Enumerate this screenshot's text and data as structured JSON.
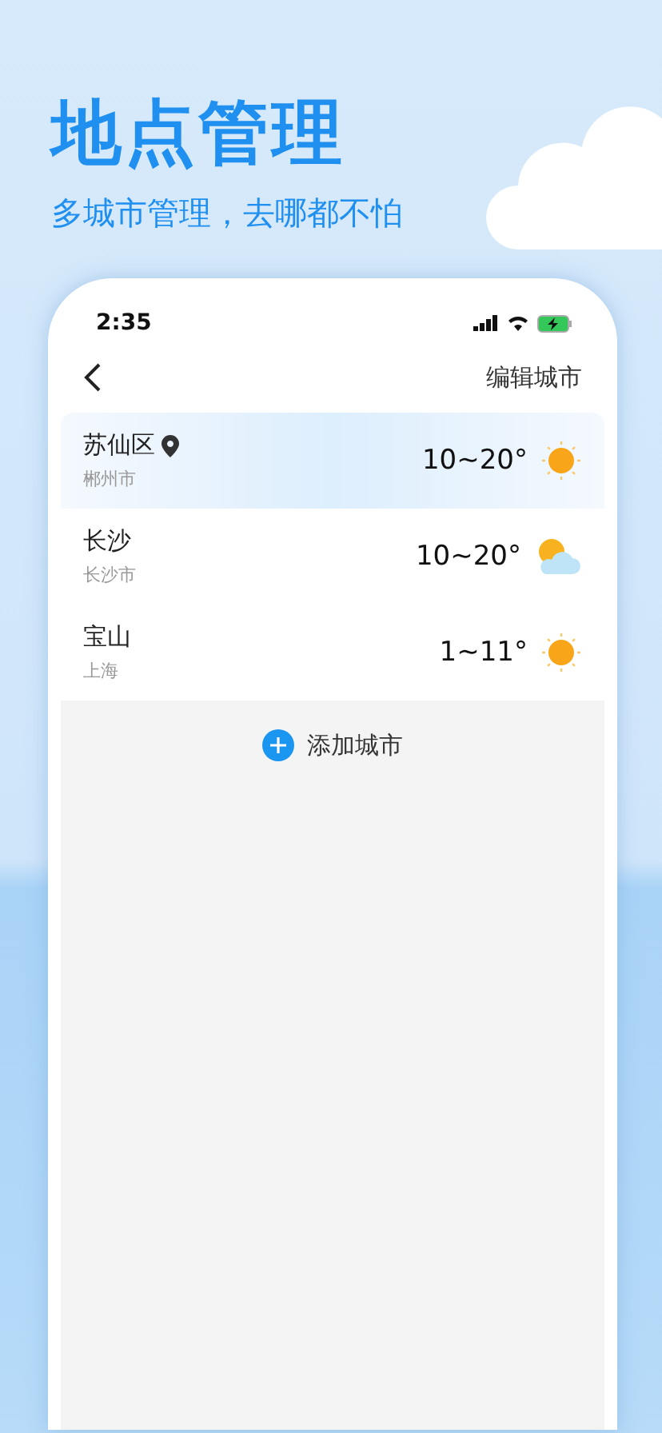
{
  "headline": {
    "title": "地点管理",
    "subtitle": "多城市管理，去哪都不怕"
  },
  "status_bar": {
    "time": "2:35"
  },
  "nav": {
    "action": "编辑城市"
  },
  "cities": [
    {
      "name": "苏仙区",
      "region": "郴州市",
      "located": true,
      "selected": true,
      "temps": "10~20°",
      "weather_icon": {
        "kind": "sun"
      }
    },
    {
      "name": "长沙",
      "region": "长沙市",
      "located": false,
      "selected": false,
      "temps": "10~20°",
      "weather_icon": {
        "kind": "sun-cloud"
      }
    },
    {
      "name": "宝山",
      "region": "上海",
      "located": false,
      "selected": false,
      "temps": "1~11°",
      "weather_icon": {
        "kind": "sun"
      }
    }
  ],
  "add_button": "添加城市"
}
